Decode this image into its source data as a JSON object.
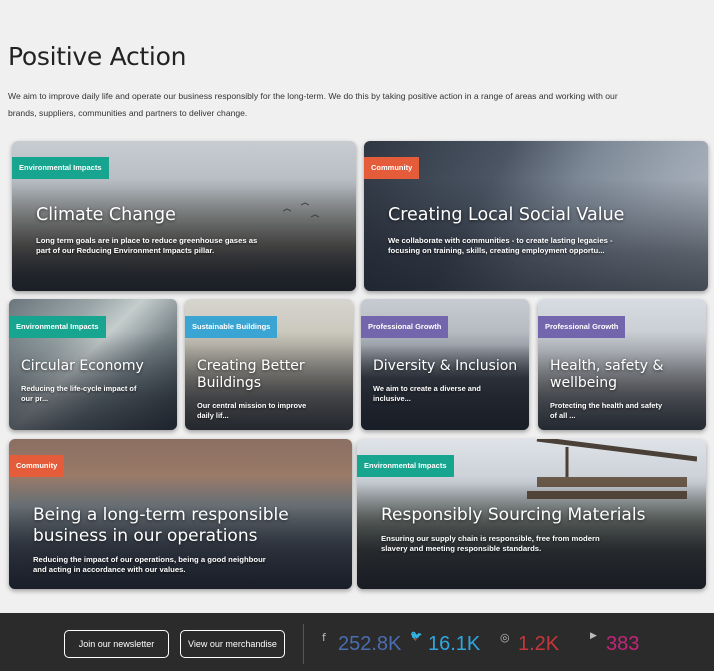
{
  "page": {
    "title": "Positive Action",
    "intro": "We aim to improve daily life and operate our business responsibly for the long-term. We do this by taking positive action in a range of areas and working with our brands, suppliers, communities and partners to deliver change."
  },
  "cards": {
    "climate": {
      "tag": "Environmental Impacts",
      "title": "Climate Change",
      "desc": "Long term goals are in place to reduce greenhouse gases as part of our Reducing Environment Impacts pillar."
    },
    "social": {
      "tag": "Community",
      "title": "Creating Local Social Value",
      "desc": "We collaborate with communities - to create lasting legacies - focusing on training, skills, creating employment opportu..."
    },
    "circular": {
      "tag": "Environmental Impacts",
      "title": "Circular Economy",
      "desc": "Reducing the life-cycle impact of our pr..."
    },
    "buildings": {
      "tag": "Sustainable Buildings",
      "title": "Creating Better Buildings",
      "desc": "Our central mission to improve daily lif..."
    },
    "diversity": {
      "tag": "Professional Growth",
      "title": "Diversity & Inclusion",
      "desc": "We aim to create a diverse and inclusive..."
    },
    "health": {
      "tag": "Professional Growth",
      "title": "Health, safety & wellbeing",
      "desc": "Protecting the health and safety of all ..."
    },
    "operations": {
      "tag": "Community",
      "title": "Being a long-term responsible business in our operations",
      "desc": "Reducing the impact of our operations, being a good neighbour and acting in accordance with our values."
    },
    "sourcing": {
      "tag": "Environmental Impacts",
      "title": "Responsibly Sourcing Materials",
      "desc": "Ensuring our supply chain is responsible, free from modern slavery and meeting responsible standards."
    }
  },
  "footer": {
    "newsletter_label": "Join our newsletter",
    "merch_label": "View our merchandise",
    "social": {
      "facebook": {
        "icon": "f",
        "count": "252.8K",
        "color": "#4a6db0"
      },
      "twitter": {
        "icon": "🐦",
        "count": "16.1K",
        "color": "#2ea7e0"
      },
      "instagram": {
        "icon": "◎",
        "count": "1.2K",
        "color": "#c5363a"
      },
      "youtube": {
        "icon": "▶",
        "count": "383",
        "color": "#c2257a"
      }
    }
  }
}
